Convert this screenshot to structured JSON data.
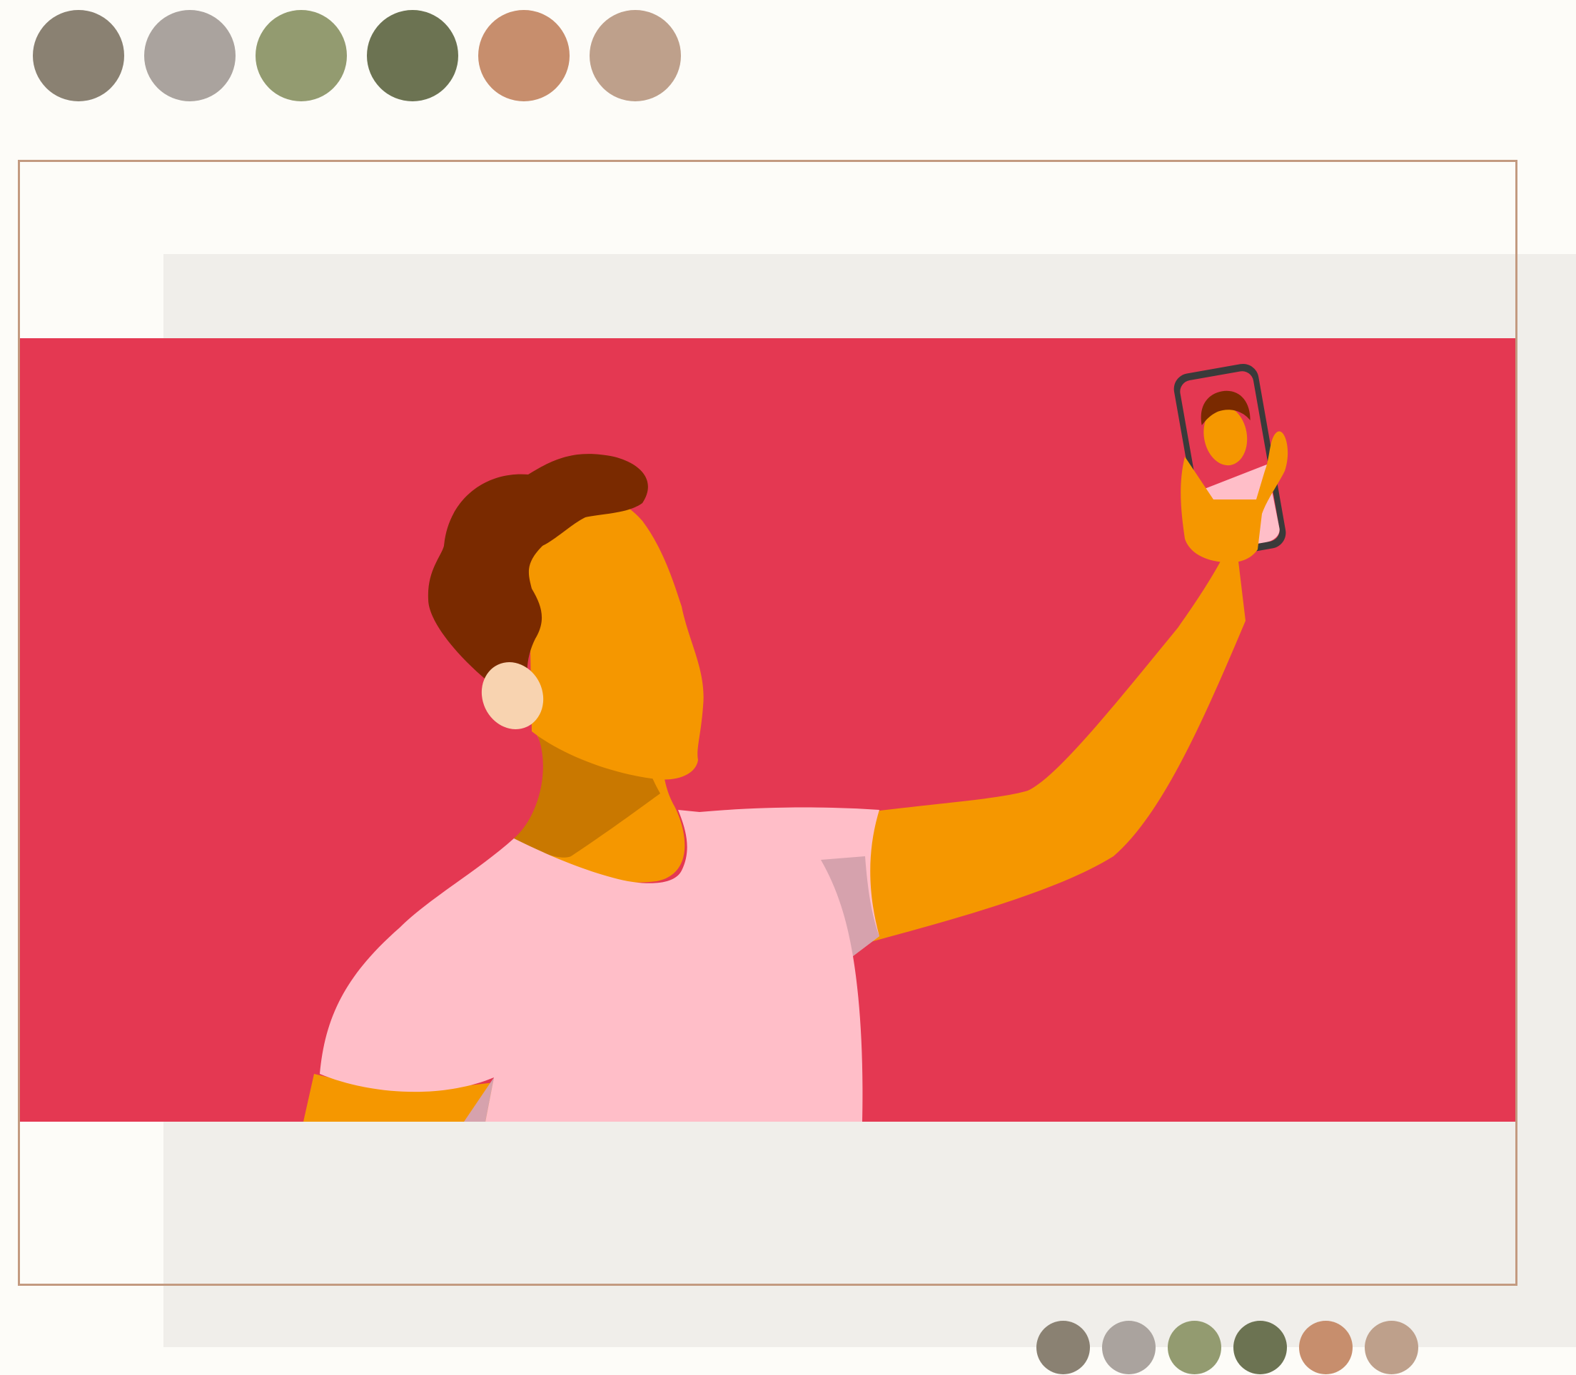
{
  "palette": {
    "colors": [
      "#8a8172",
      "#aaa39e",
      "#939b70",
      "#6c7352",
      "#c78e6d",
      "#bea08b"
    ]
  },
  "illustration": {
    "background_color": "#e43852",
    "skin_color": "#f59700",
    "skin_shadow_color": "#c97800",
    "hair_color": "#7a2a00",
    "ear_color": "#f8d3b0",
    "shirt_color": "#ffbec8",
    "shirt_shadow_color": "#d6a2ad",
    "phone_color": "#3a3a3a"
  }
}
